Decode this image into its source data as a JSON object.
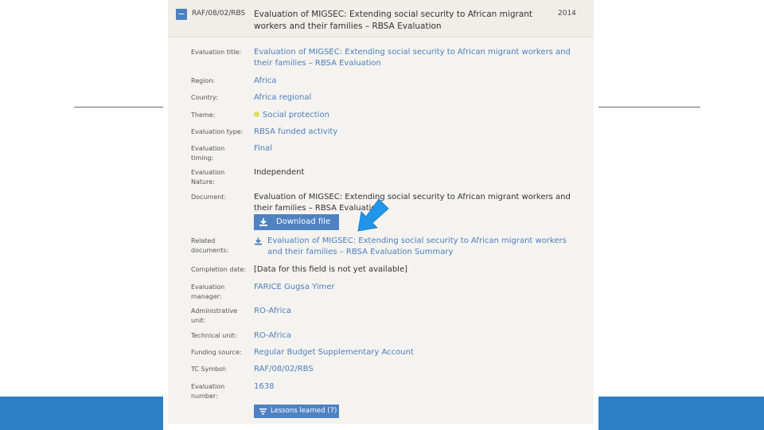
{
  "header": {
    "collapse_symbol": "−",
    "code": "RAF/08/02/RBS",
    "title": "Evaluation of MIGSEC: Extending social security to African migrant workers and their families – RBSA Evaluation",
    "year": "2014"
  },
  "fields": {
    "evaluation_title": {
      "label": "Evaluation title:",
      "value": "Evaluation of MIGSEC: Extending social security to African migrant workers and their families – RBSA Evaluation"
    },
    "region": {
      "label": "Region:",
      "value": "Africa"
    },
    "country": {
      "label": "Country:",
      "value": "Africa regional"
    },
    "theme": {
      "label": "Theme:",
      "value": "Social protection"
    },
    "evaluation_type": {
      "label": "Evaluation type:",
      "value": "RBSA funded activity"
    },
    "evaluation_timing": {
      "label": "Evaluation timing:",
      "value": "Final"
    },
    "evaluation_nature": {
      "label": "Evaluation Nature:",
      "value": "Independent"
    },
    "document": {
      "label": "Document:",
      "value": "Evaluation of MIGSEC: Extending social security to African migrant workers and their families – RBSA Evaluation"
    },
    "related_documents": {
      "label": "Related documents:",
      "value": "Evaluation of MIGSEC: Extending social security to African migrant workers and their families – RBSA Evaluation Summary"
    },
    "completion_date": {
      "label": "Completion date:",
      "value": "[Data for this field is not yet available]"
    },
    "evaluation_manager": {
      "label": "Evaluation manager:",
      "value": "FARICE Gugsa Yimer"
    },
    "administrative_unit": {
      "label": "Administrative unit:",
      "value": "RO-Africa"
    },
    "technical_unit": {
      "label": "Technical unit:",
      "value": "RO-Africa"
    },
    "funding_source": {
      "label": "Funding source:",
      "value": "Regular Budget Supplementary Account"
    },
    "tc_symbol": {
      "label": "TC Symbol:",
      "value": "RAF/08/02/RBS"
    },
    "evaluation_number": {
      "label": "Evaluation number:",
      "value": "1638"
    }
  },
  "buttons": {
    "download_file": "Download file",
    "lessons_learned": "Lessons learned (7)"
  },
  "colors": {
    "link": "#4a7fc0",
    "button": "#4f82c2",
    "slide_bar": "#2d7fc6",
    "arrow": "#2196e8",
    "theme_dot": "#d9df5f"
  },
  "icons": {
    "collapse": "minus-icon",
    "download": "download-icon",
    "lessons": "filter-icon",
    "arrow": "pointer-arrow-icon"
  }
}
